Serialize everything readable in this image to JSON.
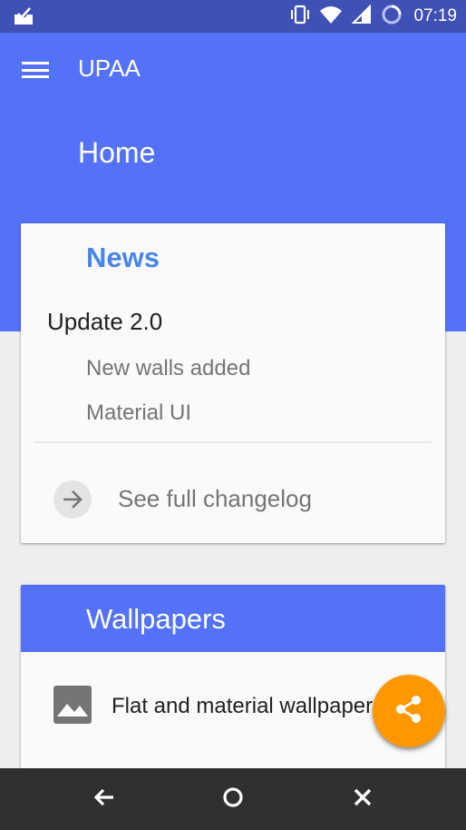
{
  "status_bar": {
    "time": "07:19",
    "icons": [
      "notification-inbox-icon",
      "vibrate-icon",
      "wifi-icon",
      "signal-icon",
      "battery-loading-icon"
    ]
  },
  "app_bar": {
    "title": "UPAA",
    "page_title": "Home",
    "menu_icon": "hamburger-menu-icon",
    "color": "#5472f7"
  },
  "news_card": {
    "title": "News",
    "update_title": "Update 2.0",
    "items": [
      "New walls added",
      "Material UI"
    ],
    "changelog_label": "See full changelog",
    "changelog_icon": "arrow-right-icon",
    "accent": "#4a86e8"
  },
  "wallpapers_card": {
    "title": "Wallpapers",
    "item_label": "Flat and material wallpapers",
    "item_icon": "image-icon"
  },
  "fab": {
    "icon": "share-icon",
    "color": "#ff9800"
  },
  "nav_bar": {
    "buttons": [
      "back-icon",
      "home-icon",
      "close-icon"
    ]
  }
}
